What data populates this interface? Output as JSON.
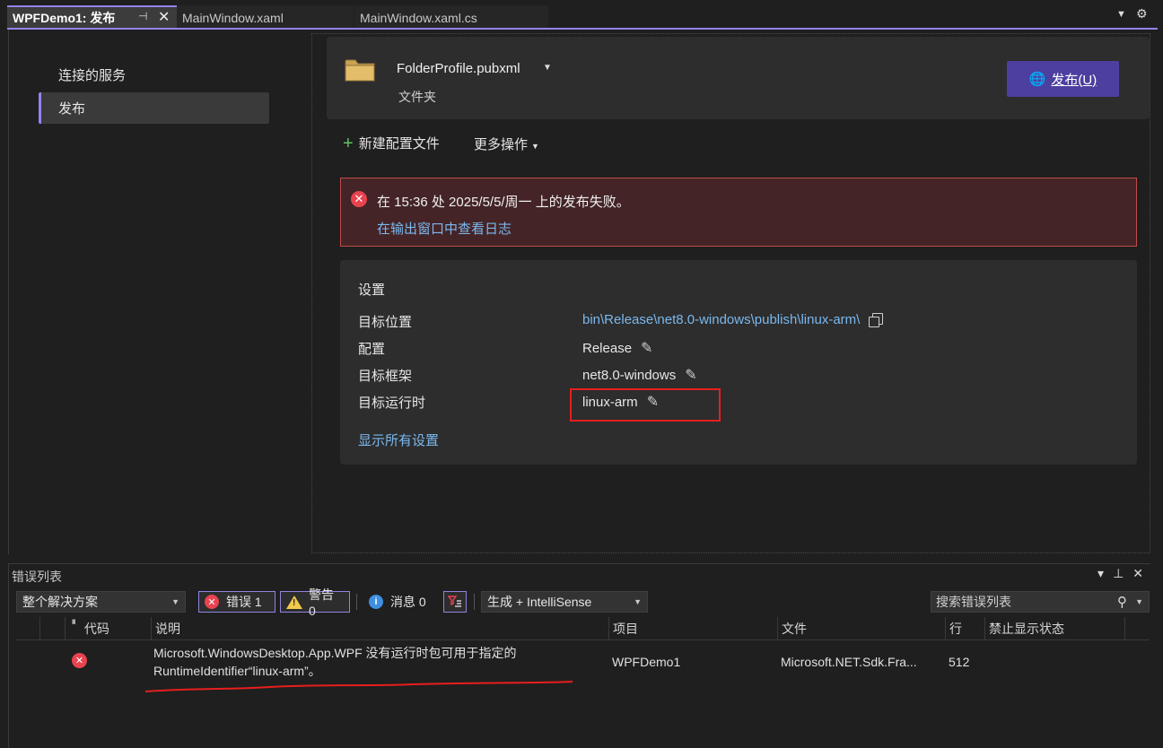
{
  "tabs": [
    {
      "label": "WPFDemo1: 发布",
      "active": true
    },
    {
      "label": "MainWindow.xaml",
      "active": false
    },
    {
      "label": "MainWindow.xaml.cs",
      "active": false
    }
  ],
  "tab_icons": {
    "pin": "⊣",
    "close": "✕",
    "dropdown": "▼",
    "settings": "⚙"
  },
  "nav": {
    "services": "连接的服务",
    "publish": "发布"
  },
  "profile": {
    "name": "FolderProfile.pubxml",
    "subtitle": "文件夹",
    "publish_button": "发布(U)"
  },
  "actions": {
    "new_profile": "新建配置文件",
    "more_actions": "更多操作"
  },
  "error_banner": {
    "message": "在 15:36 处 2025/5/5/周一 上的发布失败。",
    "link": "在输出窗口中查看日志"
  },
  "settings": {
    "title": "设置",
    "rows": [
      {
        "label": "目标位置",
        "value": "bin\\Release\\net8.0-windows\\publish\\linux-arm\\"
      },
      {
        "label": "配置",
        "value": "Release"
      },
      {
        "label": "目标框架",
        "value": "net8.0-windows"
      },
      {
        "label": "目标运行时",
        "value": "linux-arm"
      }
    ],
    "show_all": "显示所有设置"
  },
  "error_list": {
    "title": "错误列表",
    "scope": "整个解决方案",
    "errors_label": "错误 1",
    "warnings_label": "警告 0",
    "messages_label": "消息 0",
    "source": "生成 + IntelliSense",
    "search_placeholder": "搜索错误列表",
    "columns": [
      "代码",
      "说明",
      "项目",
      "文件",
      "行",
      "禁止显示状态"
    ],
    "rows": [
      {
        "code": "",
        "description": "Microsoft.WindowsDesktop.App.WPF 没有运行时包可用于指定的 RuntimeIdentifier“linux-arm”。",
        "project": "WPFDemo1",
        "file": "Microsoft.NET.Sdk.Fra...",
        "line": "512",
        "suppression": ""
      }
    ]
  },
  "colors": {
    "accent": "#9184ee",
    "publish_button": "#4d3f9f",
    "error_red": "#e8434f",
    "link": "#7ab8ee",
    "highlight_box": "#e81e1e"
  }
}
